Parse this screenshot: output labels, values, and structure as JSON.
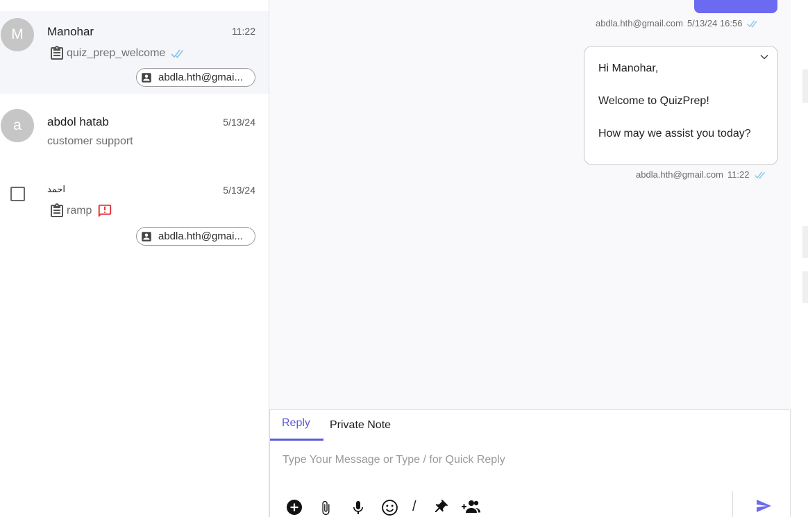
{
  "colors": {
    "accent": "#6c6af0",
    "tick": "#7fc4ec",
    "alert": "#e0292f",
    "active_row": "#f5f6fa"
  },
  "conversations": [
    {
      "avatar_letter": "M",
      "name": "Manohar",
      "time": "11:22",
      "preview": "quiz_prep_welcome",
      "preview_icon": "clipboard-icon",
      "status_icon": "double-check-icon",
      "chip": "abdla.hth@gmai..."
    },
    {
      "avatar_letter": "a",
      "name": "abdol hatab",
      "time": "5/13/24",
      "preview": "customer support"
    },
    {
      "name": "احمد",
      "time": "5/13/24",
      "preview": "ramp",
      "preview_icon": "clipboard-icon",
      "status_icon": "alert-message-icon",
      "chip": "abdla.hth@gmai..."
    }
  ],
  "chat": {
    "messages": [
      {
        "meta_sender": "abdla.hth@gmail.com",
        "meta_time": "5/13/24 16:56"
      },
      {
        "lines": [
          "Hi Manohar,",
          "Welcome to QuizPrep!",
          "How may we assist you today?"
        ],
        "meta_sender": "abdla.hth@gmail.com",
        "meta_time": "11:22"
      }
    ]
  },
  "composer": {
    "tabs": [
      "Reply",
      "Private Note"
    ],
    "active_tab": "Reply",
    "placeholder": "Type Your Message or Type / for Quick Reply",
    "value": "",
    "slash": "/",
    "tools": [
      "add-circle-icon",
      "paperclip-icon",
      "microphone-icon",
      "emoji-icon",
      "pin-icon",
      "add-people-icon"
    ]
  }
}
